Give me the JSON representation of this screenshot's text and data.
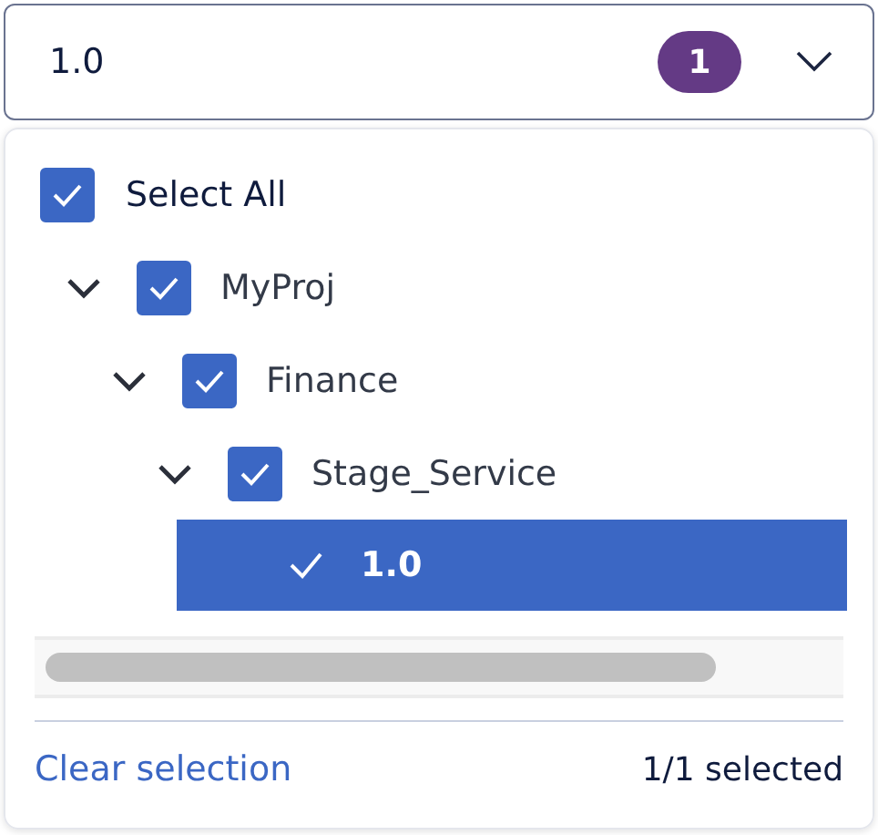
{
  "field": {
    "value": "1.0",
    "badge": "1"
  },
  "select_all": {
    "label": "Select All",
    "checked": true
  },
  "tree": [
    {
      "label": "MyProj",
      "expanded": true,
      "checked": true,
      "children": [
        {
          "label": "Finance",
          "expanded": true,
          "checked": true,
          "children": [
            {
              "label": "Stage_Service",
              "expanded": true,
              "checked": true,
              "children": [
                {
                  "label": "1.0",
                  "kind": "leaf",
                  "selected": true
                }
              ]
            }
          ]
        }
      ]
    }
  ],
  "footer": {
    "link": "Clear selection",
    "count": "1/1 selected"
  }
}
